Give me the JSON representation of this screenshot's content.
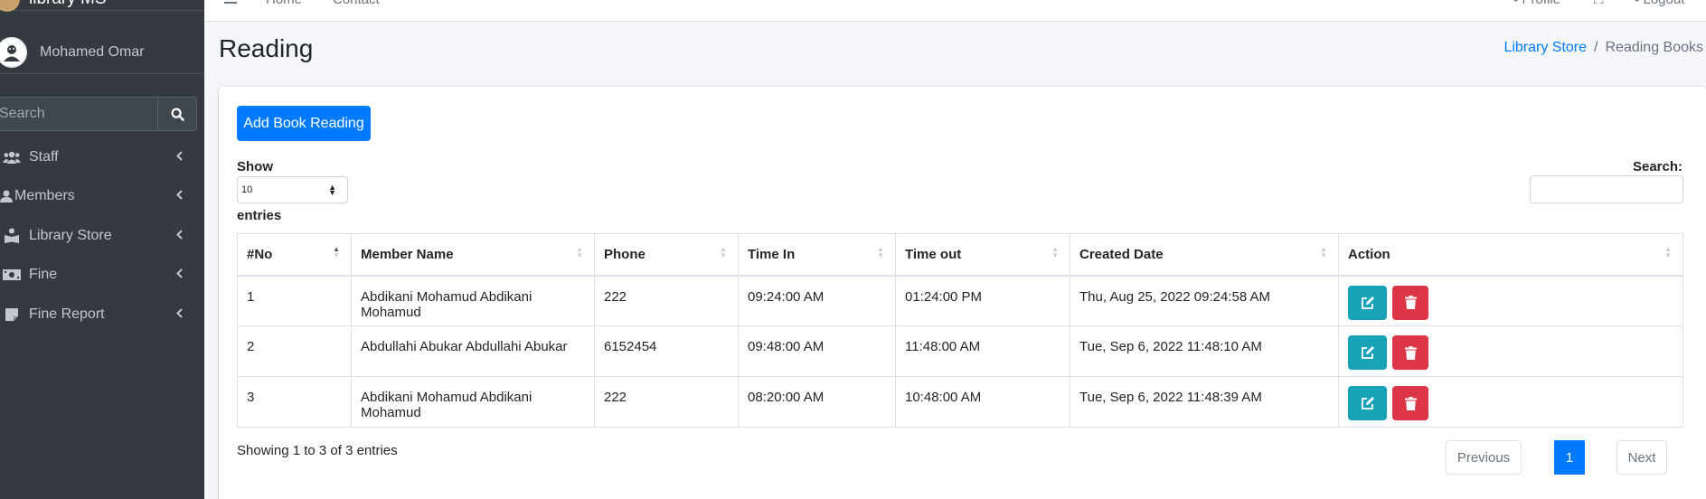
{
  "sidebar": {
    "brand": "library MS",
    "user_name": "Mohamed Omar",
    "search_placeholder": "Search",
    "items": [
      {
        "label": "Staff",
        "icon": "users-icon"
      },
      {
        "label": "Members",
        "icon": "user-icon"
      },
      {
        "label": "Library Store",
        "icon": "book-reader-icon"
      },
      {
        "label": "Fine",
        "icon": "money-bill-icon"
      },
      {
        "label": "Fine Report",
        "icon": "sticky-note-icon"
      }
    ]
  },
  "topbar": {
    "home": "Home",
    "contact": "Contact",
    "profile": "Profile",
    "logout": "Logout"
  },
  "header": {
    "title": "Reading",
    "breadcrumb": {
      "parent": "Library Store",
      "separator": "/",
      "current": "Reading Books"
    }
  },
  "card": {
    "add_button": "Add Book Reading",
    "show_label": "Show",
    "length_value": "10",
    "entries_label": "entries",
    "search_label": "Search:",
    "columns": [
      "#No",
      "Member Name",
      "Phone",
      "Time In",
      "Time out",
      "Created Date",
      "Action"
    ],
    "rows": [
      [
        "1",
        "Abdikani Mohamud Abdikani Mohamud",
        "222",
        "09:24:00 AM",
        "01:24:00 PM",
        "Thu, Aug 25, 2022 09:24:58 AM"
      ],
      [
        "2",
        "Abdullahi Abukar Abdullahi Abukar",
        "6152454",
        "09:48:00 AM",
        "11:48:00 AM",
        "Tue, Sep 6, 2022 11:48:10 AM"
      ],
      [
        "3",
        "Abdikani Mohamud Abdikani Mohamud",
        "222",
        "08:20:00 AM",
        "10:48:00 AM",
        "Tue, Sep 6, 2022 11:48:39 AM"
      ]
    ],
    "info": "Showing 1 to 3 of 3 entries",
    "pagination": {
      "previous": "Previous",
      "page": "1",
      "next": "Next"
    }
  },
  "colors": {
    "primary": "#007bff",
    "info": "#17a2b8",
    "danger": "#dc3545",
    "sidebar": "#343a40"
  }
}
